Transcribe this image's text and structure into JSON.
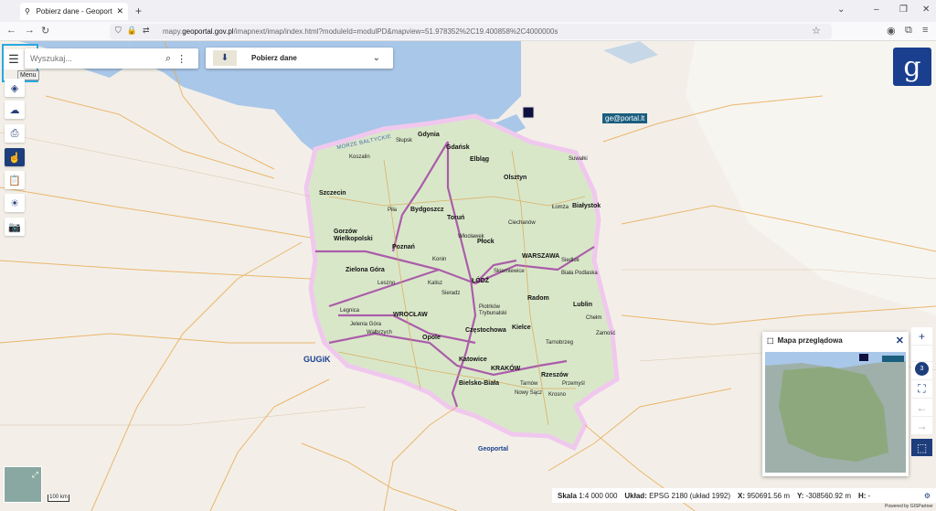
{
  "browser": {
    "tab_title": "Pobierz dane - Geoportal - GUGIK",
    "url_prefix": "mapy.",
    "url_domain": "geoportal.gov.pl",
    "url_rest": "/imapnext/imap/index.html?moduleId=modulPD&mapview=51.978352%2C19.400858%2C4000000s"
  },
  "search": {
    "placeholder": "Wyszukaj..."
  },
  "menu": {
    "tooltip": "Menu"
  },
  "download": {
    "label": "Pobierz dane"
  },
  "overview": {
    "title": "Mapa przeglądowa"
  },
  "zoom": {
    "level": "3"
  },
  "status": {
    "scale_label": "Skala",
    "scale_value": "1:4 000 000",
    "crs_label": "Układ:",
    "crs_value": "EPSG 2180 (układ 1992)",
    "x_label": "X:",
    "x_value": "950691.56 m",
    "y_label": "Y:",
    "y_value": "-308560.92 m",
    "h_label": "H:",
    "h_value": "-",
    "powered": "Powered by GISPartner"
  },
  "scalebar": "100 km",
  "map_labels": {
    "sea": "MORZE BAŁTYCKIE",
    "cities": [
      "Gdynia",
      "Gdańsk",
      "Słupsk",
      "Koszalin",
      "Elbląg",
      "Olsztyn",
      "Suwałki",
      "Szczecin",
      "Bydgoszcz",
      "Toruń",
      "Białystok",
      "Łomża",
      "Ciechanów",
      "Piła",
      "Gorzów Wielkopolski",
      "Płock",
      "Włocławek",
      "Poznań",
      "Konin",
      "WARSZAWA",
      "Siedlce",
      "Biała Podlaska",
      "Zielona Góra",
      "Leszno",
      "Kalisz",
      "Sieradz",
      "ŁÓDŹ",
      "Skierniewice",
      "Radom",
      "Lublin",
      "Chełm",
      "Legnica",
      "WROCŁAW",
      "Jelenia Góra",
      "Wałbrzych",
      "Piotrków Trybunalski",
      "Częstochowa",
      "Kielce",
      "Zamość",
      "Opole",
      "Tarnobrzeg",
      "Katowice",
      "KRAKÓW",
      "Rzeszów",
      "Przemyśl",
      "Tarnów",
      "Bielsko-Biała",
      "Nowy Sącz",
      "Krosno"
    ],
    "lt_badge": "ge@portal.lt",
    "gugik": "GUGiK",
    "geoportal": "Geoportal"
  },
  "colors": {
    "accent": "#1e3d7b",
    "highlight": "#29a8e0",
    "water": "#a9c7e8"
  }
}
